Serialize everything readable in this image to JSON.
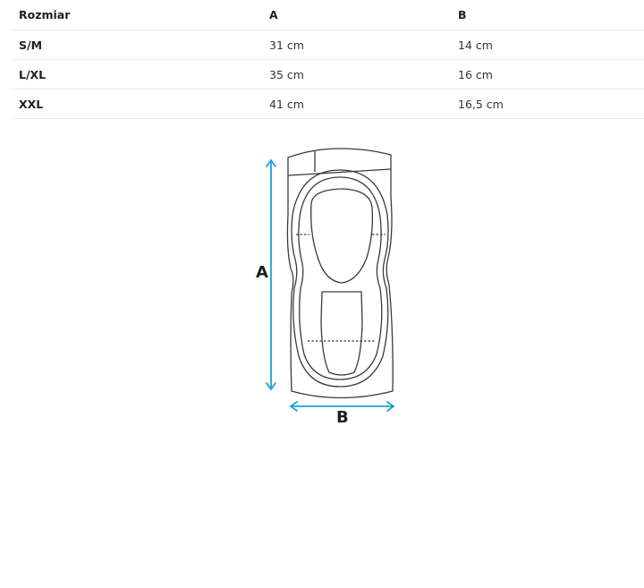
{
  "table": {
    "headers": [
      "Rozmiar",
      "A",
      "B"
    ],
    "rows": [
      {
        "size": "S/M",
        "a": "31 cm",
        "b": "14 cm"
      },
      {
        "size": "L/XL",
        "a": "35 cm",
        "b": "16 cm"
      },
      {
        "size": "XXL",
        "a": "41 cm",
        "b": "16,5 cm"
      }
    ]
  },
  "diagram": {
    "label_a": "A",
    "label_b": "B",
    "arrow_color": "#1aa3d9",
    "line_color": "#3a3a3a"
  }
}
